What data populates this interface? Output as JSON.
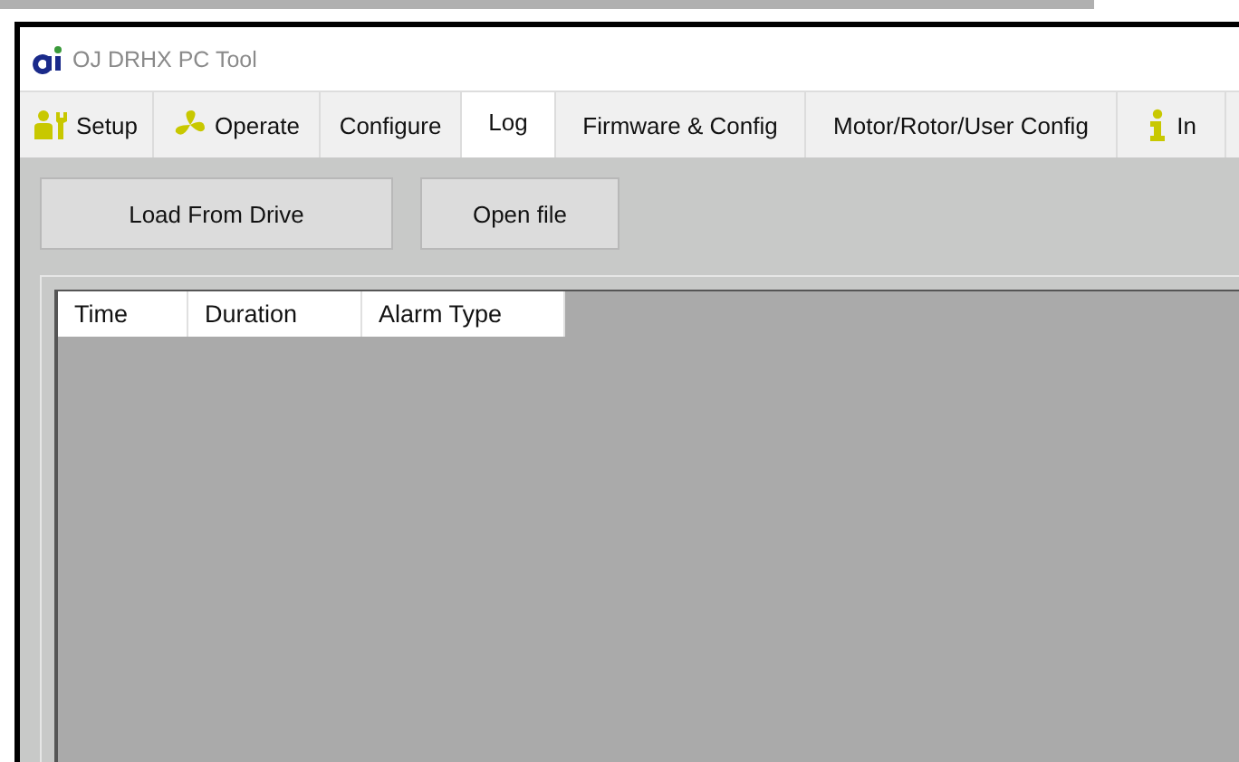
{
  "window": {
    "title": "OJ DRHX PC Tool"
  },
  "tabs": [
    {
      "label": "Setup",
      "kind": "icon",
      "selected": false
    },
    {
      "label": "Operate",
      "kind": "icon",
      "selected": false
    },
    {
      "label": "Configure",
      "kind": "text",
      "selected": false
    },
    {
      "label": "Log",
      "kind": "text",
      "selected": true
    },
    {
      "label": "Firmware & Config",
      "kind": "text",
      "selected": false
    },
    {
      "label": "Motor/Rotor/User Config",
      "kind": "text",
      "selected": false
    },
    {
      "label": "In",
      "kind": "icon",
      "selected": false
    }
  ],
  "buttons": [
    "Load From Drive",
    "Open file"
  ],
  "table": {
    "columns": [
      "Time",
      "Duration",
      "Alarm Type"
    ]
  }
}
